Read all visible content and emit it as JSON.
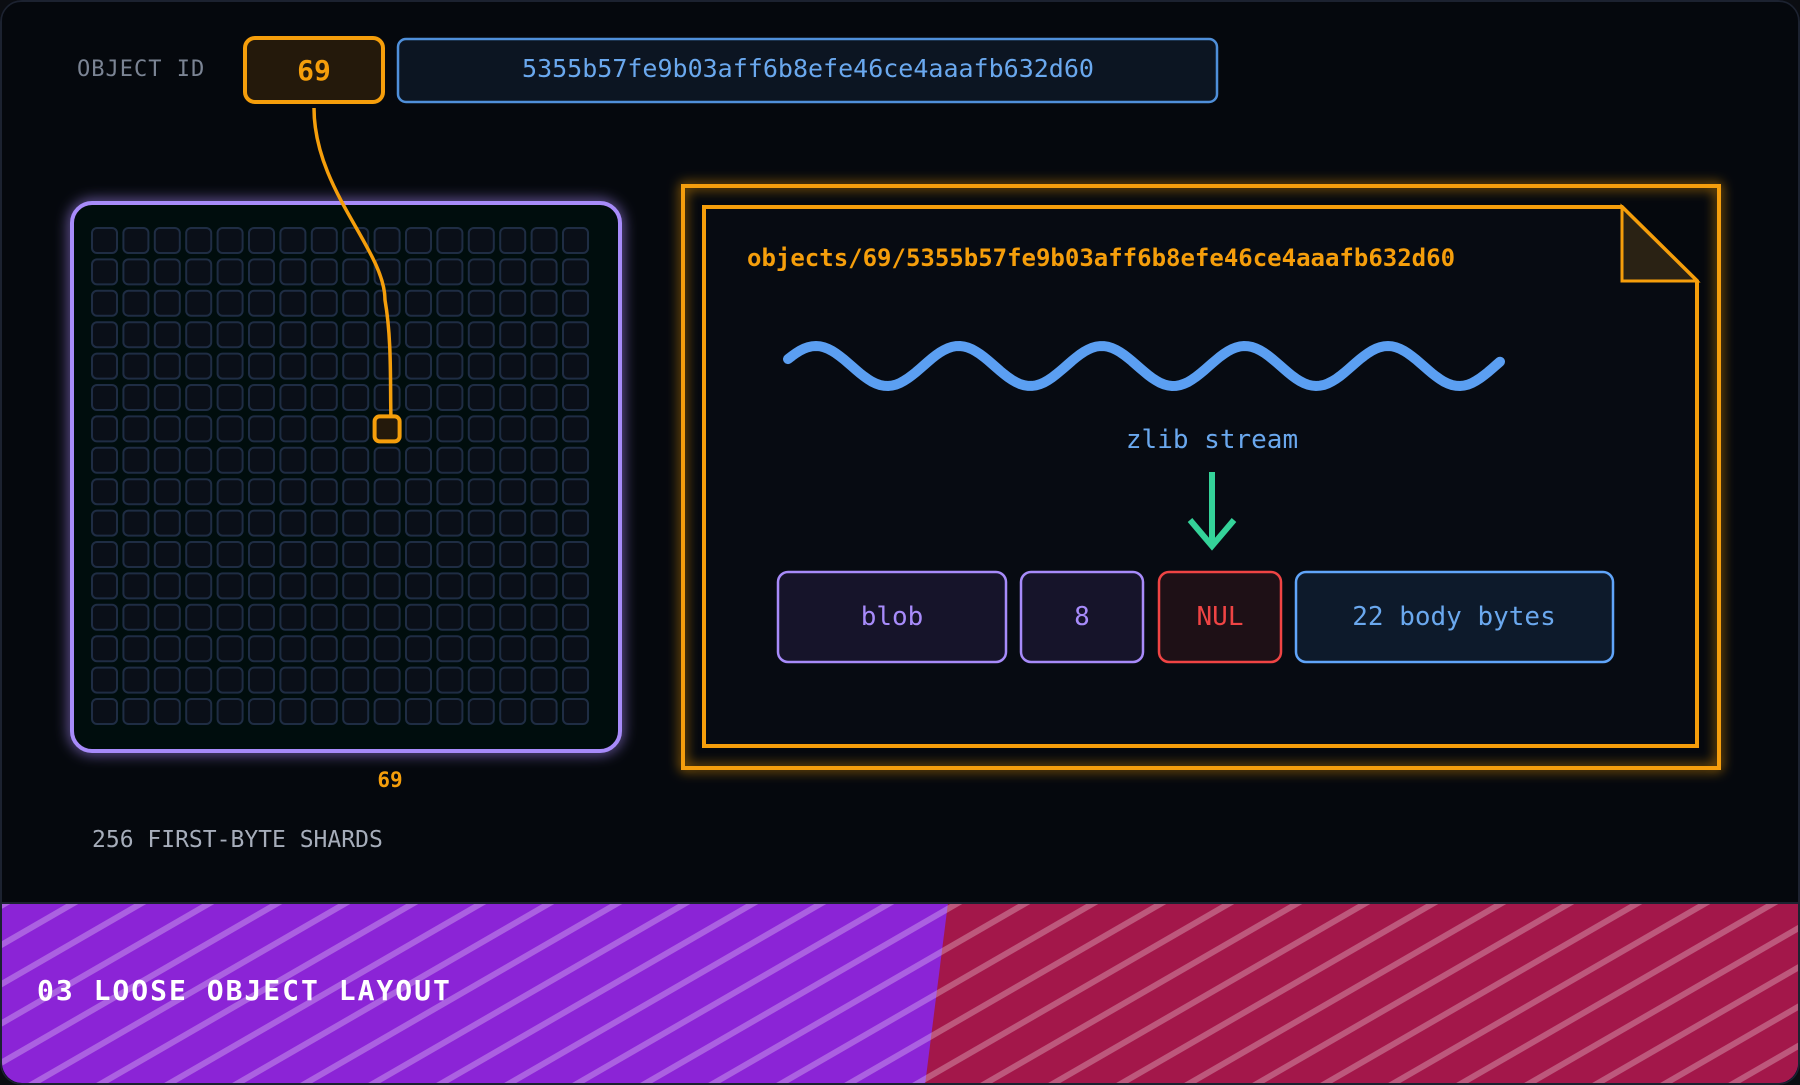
{
  "header": {
    "object_id_label": "OBJECT ID",
    "id_prefix": "69",
    "id_rest": "5355b57fe9b03aff6b8efe46ce4aaafb632d60"
  },
  "shard_grid": {
    "rows": 16,
    "cols": 16,
    "highlight_index": 105,
    "highlight_label": "69",
    "caption": "256 FIRST-BYTE SHARDS"
  },
  "object_file": {
    "path": "objects/69/5355b57fe9b03aff6b8efe46ce4aaafb632d60",
    "stream_label": "zlib stream",
    "fields": [
      {
        "label": "blob",
        "kind": "type"
      },
      {
        "label": "8",
        "kind": "size"
      },
      {
        "label": "NUL",
        "kind": "nul"
      },
      {
        "label": "22 body bytes",
        "kind": "body"
      }
    ]
  },
  "footer": {
    "title": "03 LOOSE OBJECT LAYOUT"
  },
  "colors": {
    "orange": "#f59e0b",
    "purple": "#a78bfa",
    "blue": "#60a5fa",
    "red": "#ef4444",
    "green": "#34d399",
    "banner_purple": "#8b24d6",
    "banner_red": "#a3174a"
  }
}
